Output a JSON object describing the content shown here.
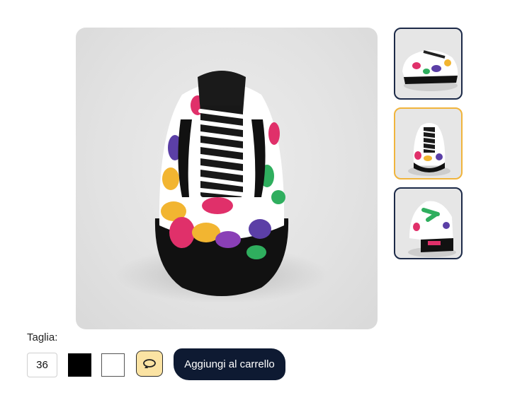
{
  "product": {
    "main_image_alt": "",
    "thumbnails": [
      {
        "name": "thumb-side-view",
        "selected": false
      },
      {
        "name": "thumb-front-view",
        "selected": true
      },
      {
        "name": "thumb-back-view",
        "selected": false
      }
    ]
  },
  "controls": {
    "size_label": "Taglia:",
    "size_value": "36",
    "color_swatches": [
      {
        "name": "black",
        "color": "#000000"
      },
      {
        "name": "white",
        "color": "#ffffff"
      }
    ],
    "rotate_icon": "rotate-icon",
    "add_to_cart_label": "Aggiungi al carrello"
  },
  "colors": {
    "accent_selected": "#f0b43c",
    "thumb_border": "#1c2a48",
    "cart_button": "#0e1a32",
    "rotate_button_bg": "#fbe3a3"
  }
}
